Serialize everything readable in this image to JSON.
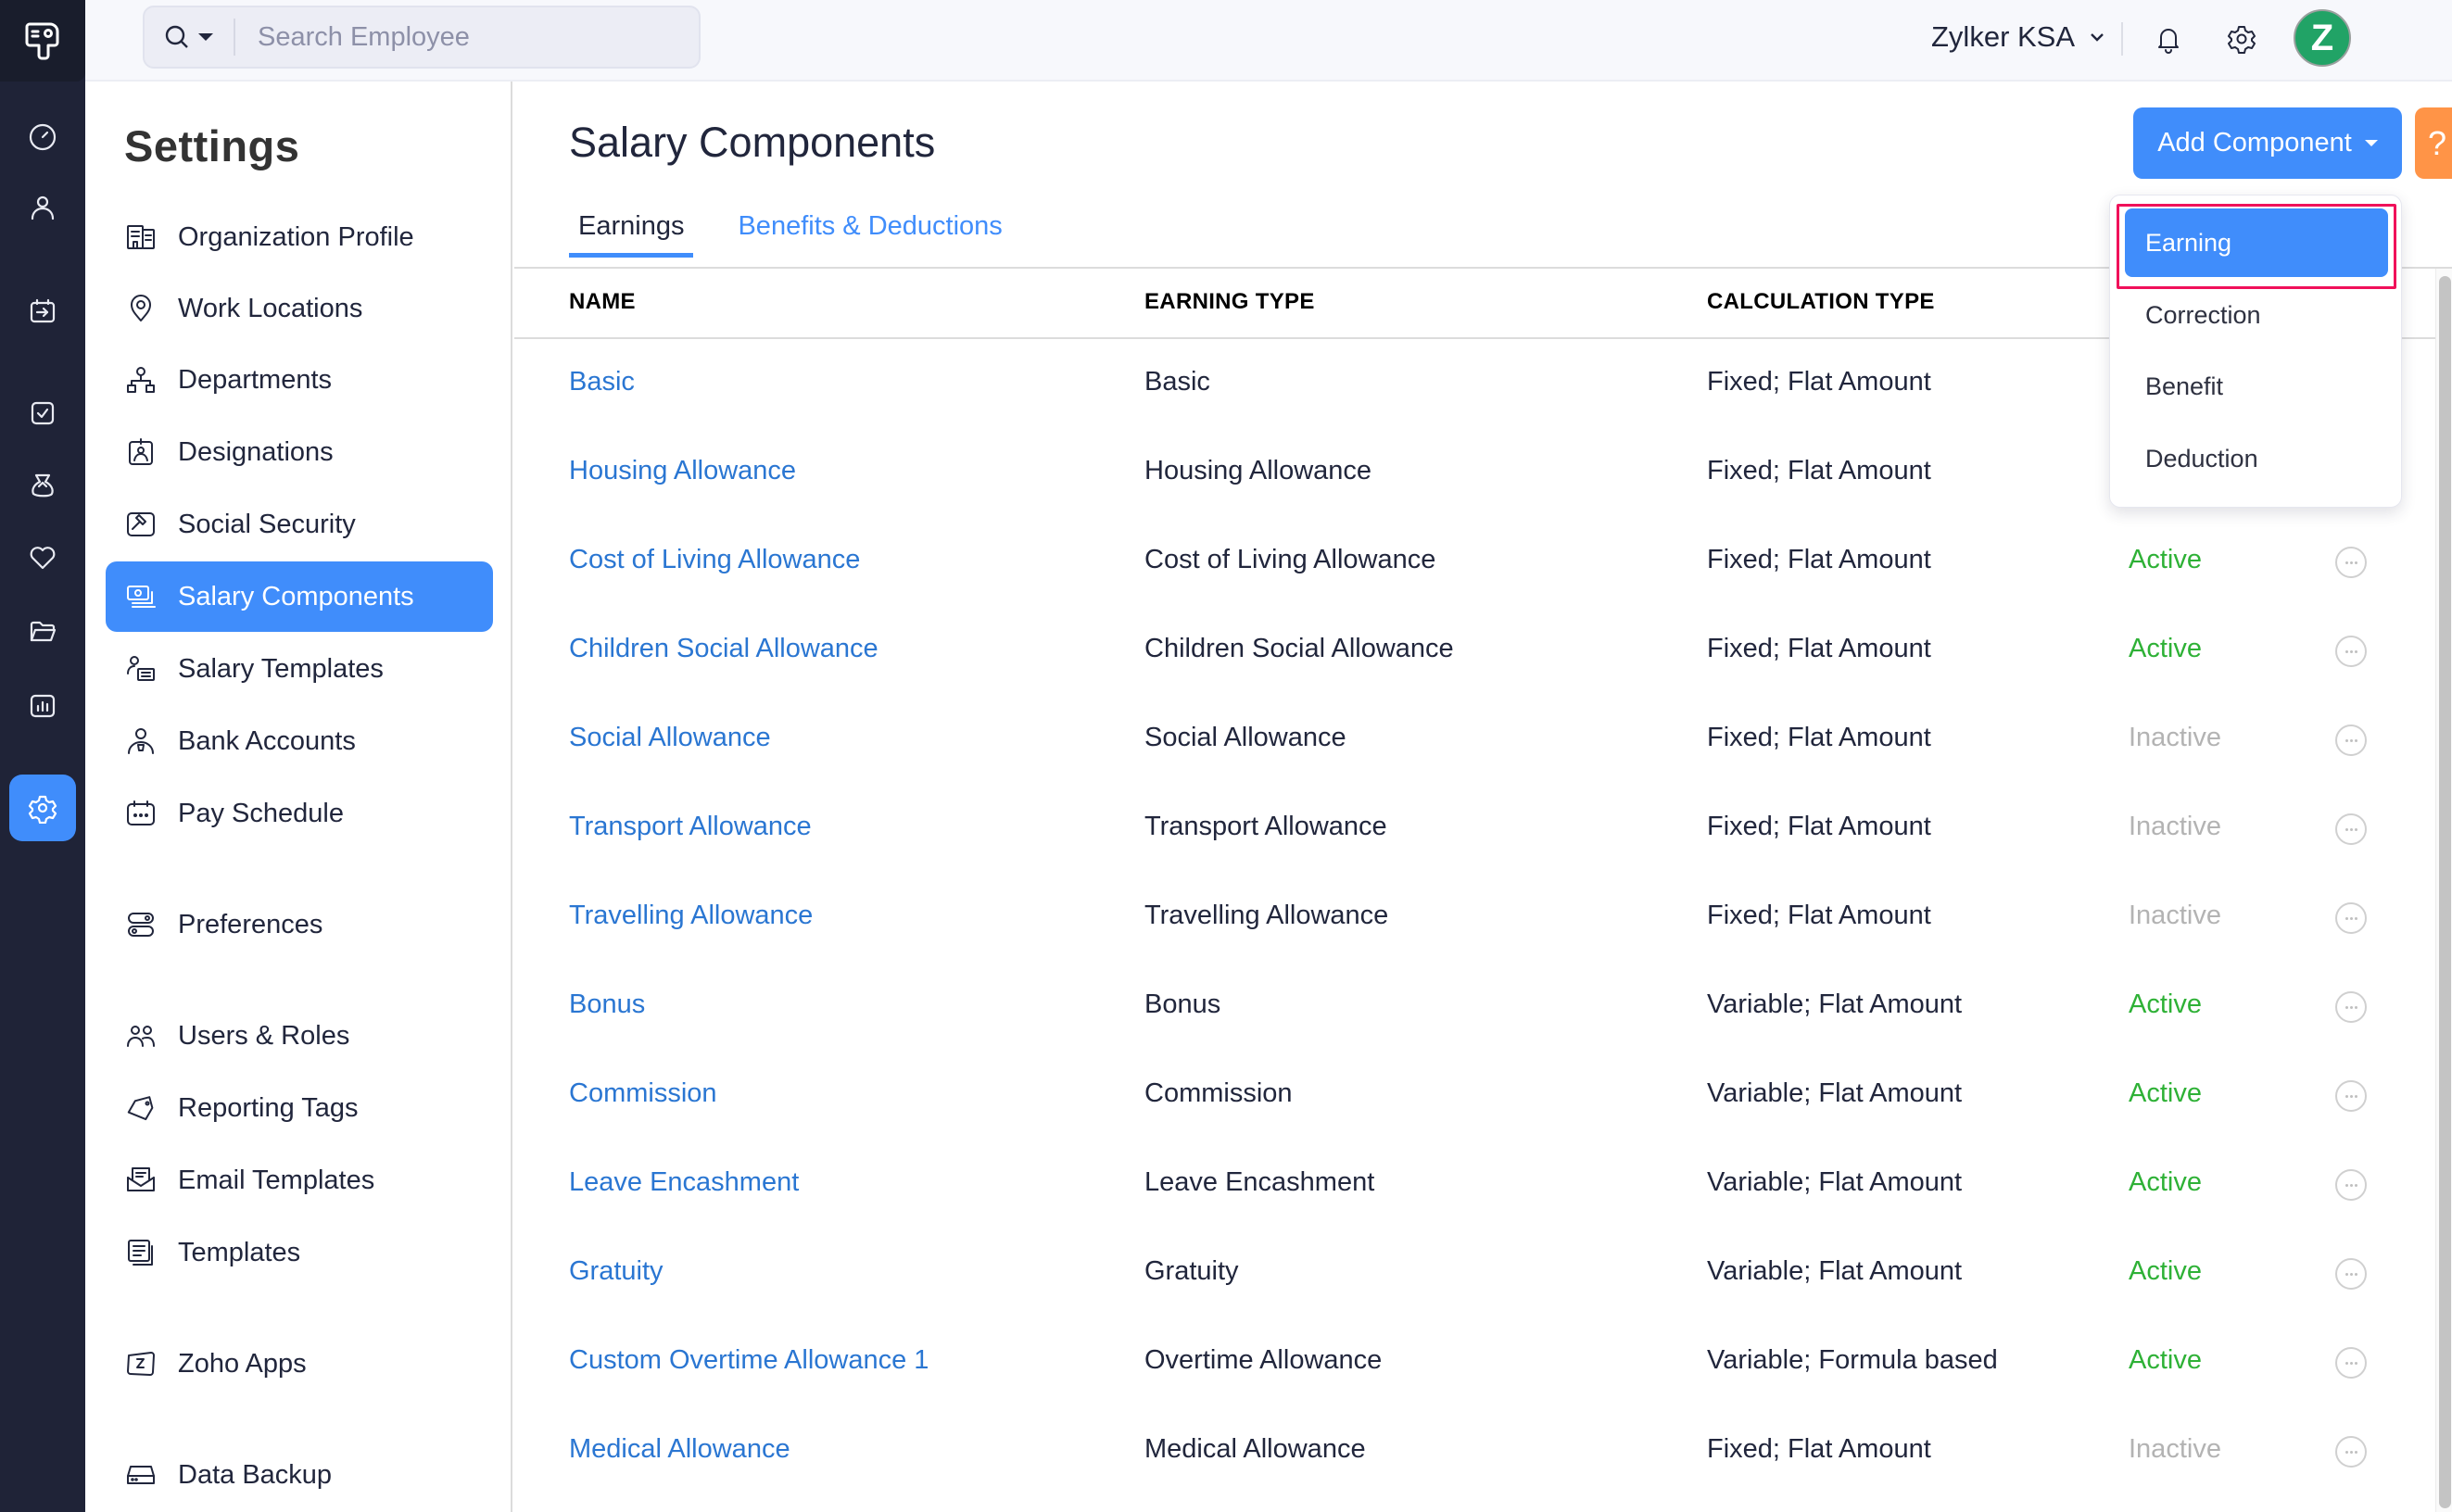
{
  "rail": {
    "items": [
      {
        "icon": "dashboard-icon",
        "label": "Dashboard"
      },
      {
        "icon": "employees-icon",
        "label": "Employees"
      },
      {
        "icon": "pay-runs-icon",
        "label": "Pay Runs"
      },
      {
        "icon": "approvals-icon",
        "label": "Approvals"
      },
      {
        "icon": "loans-icon",
        "label": "Loans"
      },
      {
        "icon": "benefits-icon",
        "label": "Benefits"
      },
      {
        "icon": "documents-icon",
        "label": "Documents"
      },
      {
        "icon": "reports-icon",
        "label": "Reports"
      },
      {
        "icon": "settings-icon",
        "label": "Settings",
        "active": true
      }
    ]
  },
  "topbar": {
    "search_placeholder": "Search Employee",
    "search_value": "",
    "org_name": "Zylker KSA",
    "avatar_letter": "Z"
  },
  "settings": {
    "title": "Settings",
    "items": [
      {
        "label": "Organization Profile",
        "icon": "building-icon"
      },
      {
        "label": "Work Locations",
        "icon": "location-pin-icon"
      },
      {
        "label": "Departments",
        "icon": "org-chart-icon"
      },
      {
        "label": "Designations",
        "icon": "id-badge-icon"
      },
      {
        "label": "Social Security",
        "icon": "gavel-icon"
      },
      {
        "label": "Salary Components",
        "icon": "money-icon",
        "active": true
      },
      {
        "label": "Salary Templates",
        "icon": "user-template-icon"
      },
      {
        "label": "Bank Accounts",
        "icon": "bank-user-icon"
      },
      {
        "label": "Pay Schedule",
        "icon": "calendar-icon"
      },
      {
        "label": "Preferences",
        "icon": "toggles-icon"
      },
      {
        "label": "Users & Roles",
        "icon": "users-icon"
      },
      {
        "label": "Reporting Tags",
        "icon": "tag-icon"
      },
      {
        "label": "Email Templates",
        "icon": "email-icon"
      },
      {
        "label": "Templates",
        "icon": "templates-icon"
      },
      {
        "label": "Zoho Apps",
        "icon": "zoho-icon"
      },
      {
        "label": "Data Backup",
        "icon": "drive-icon"
      }
    ]
  },
  "main": {
    "title": "Salary Components",
    "tabs": [
      {
        "label": "Earnings",
        "active": true
      },
      {
        "label": "Benefits & Deductions",
        "active": false
      }
    ],
    "add_button_label": "Add Component",
    "help_button_label": "?",
    "dropdown": {
      "items": [
        {
          "label": "Earning",
          "active": true
        },
        {
          "label": "Correction"
        },
        {
          "label": "Benefit"
        },
        {
          "label": "Deduction"
        }
      ]
    },
    "table": {
      "columns": [
        "NAME",
        "EARNING TYPE",
        "CALCULATION TYPE"
      ],
      "rows": [
        {
          "name": "Basic",
          "earning_type": "Basic",
          "calculation_type": "Fixed; Flat Amount",
          "status": ""
        },
        {
          "name": "Housing Allowance",
          "earning_type": "Housing Allowance",
          "calculation_type": "Fixed; Flat Amount",
          "status": ""
        },
        {
          "name": "Cost of Living Allowance",
          "earning_type": "Cost of Living Allowance",
          "calculation_type": "Fixed; Flat Amount",
          "status": "Active"
        },
        {
          "name": "Children Social Allowance",
          "earning_type": "Children Social Allowance",
          "calculation_type": "Fixed; Flat Amount",
          "status": "Active"
        },
        {
          "name": "Social Allowance",
          "earning_type": "Social Allowance",
          "calculation_type": "Fixed; Flat Amount",
          "status": "Inactive"
        },
        {
          "name": "Transport Allowance",
          "earning_type": "Transport Allowance",
          "calculation_type": "Fixed; Flat Amount",
          "status": "Inactive"
        },
        {
          "name": "Travelling Allowance",
          "earning_type": "Travelling Allowance",
          "calculation_type": "Fixed; Flat Amount",
          "status": "Inactive"
        },
        {
          "name": "Bonus",
          "earning_type": "Bonus",
          "calculation_type": "Variable; Flat Amount",
          "status": "Active"
        },
        {
          "name": "Commission",
          "earning_type": "Commission",
          "calculation_type": "Variable; Flat Amount",
          "status": "Active"
        },
        {
          "name": "Leave Encashment",
          "earning_type": "Leave Encashment",
          "calculation_type": "Variable; Flat Amount",
          "status": "Active"
        },
        {
          "name": "Gratuity",
          "earning_type": "Gratuity",
          "calculation_type": "Variable; Flat Amount",
          "status": "Active"
        },
        {
          "name": "Custom Overtime Allowance 1",
          "earning_type": "Overtime Allowance",
          "calculation_type": "Variable; Formula based",
          "status": "Active"
        },
        {
          "name": "Medical Allowance",
          "earning_type": "Medical Allowance",
          "calculation_type": "Fixed; Flat Amount",
          "status": "Inactive"
        }
      ]
    }
  },
  "colors": {
    "accent": "#408dfb",
    "rail_bg": "#1f2337",
    "link": "#2a76d2",
    "active_status": "#2eb136",
    "inactive_status": "#b3b3b3",
    "help_button": "#ff9447",
    "highlight": "#f0115a",
    "avatar": "#21a366"
  }
}
